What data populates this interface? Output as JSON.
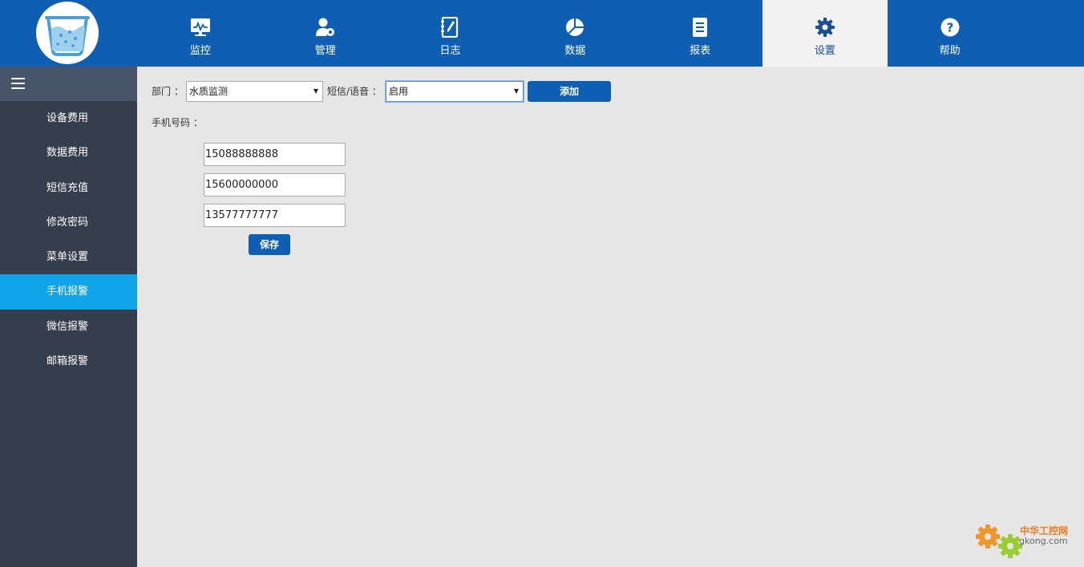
{
  "nav": {
    "items": [
      {
        "label": "监控",
        "icon": "monitor-icon"
      },
      {
        "label": "管理",
        "icon": "user-gear-icon"
      },
      {
        "label": "日志",
        "icon": "notebook-icon"
      },
      {
        "label": "数据",
        "icon": "pie-chart-icon"
      },
      {
        "label": "报表",
        "icon": "document-icon"
      },
      {
        "label": "设置",
        "icon": "gear-icon"
      },
      {
        "label": "帮助",
        "icon": "help-icon"
      }
    ],
    "active": "设置"
  },
  "sidebar": {
    "items": [
      "设备费用",
      "数据费用",
      "短信充值",
      "修改密码",
      "菜单设置",
      "手机报警",
      "微信报警",
      "邮箱报警"
    ],
    "active": "手机报警"
  },
  "form": {
    "dept_label": "部门 ：",
    "dept_value": "水质监测",
    "sms_label": "短信/语音 ：",
    "sms_value": "启用",
    "add_label": "添加",
    "phone_label": "手机号码  ：",
    "phones": [
      "15088888888",
      "15600000000",
      "13577777777"
    ],
    "save_label": "保存"
  },
  "watermark": {
    "cn": "中华工控网",
    "en": "gkong.com"
  },
  "colors": {
    "header": "#0e5fb4",
    "sidebar": "#343e4d",
    "sidebar_active": "#10a5e8",
    "button": "#0e5fb4",
    "background": "#e6e6e6"
  }
}
